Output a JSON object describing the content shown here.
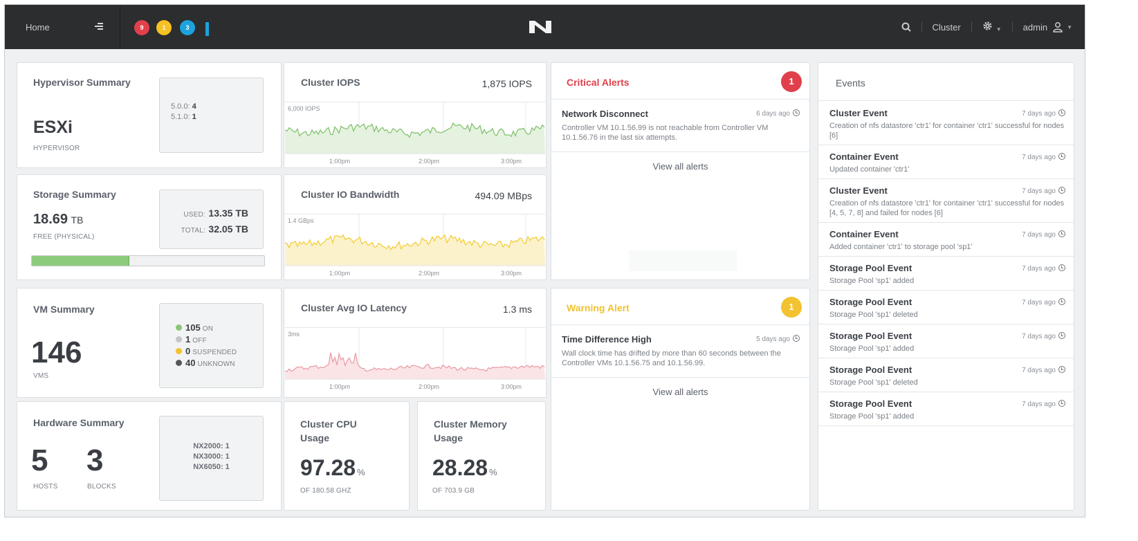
{
  "header": {
    "home_label": "Home",
    "alert_counts": {
      "critical": "9",
      "warning": "1",
      "info": "3"
    },
    "logo_text": "N",
    "cluster_label": "Cluster",
    "user_label": "admin"
  },
  "hypervisor": {
    "title": "Hypervisor Summary",
    "name": "ESXi",
    "caption": "HYPERVISOR",
    "versions": [
      {
        "label": "5.0.0:",
        "count": "4"
      },
      {
        "label": "5.1.0:",
        "count": "1"
      }
    ]
  },
  "storage": {
    "title": "Storage Summary",
    "free_value": "18.69",
    "free_unit": "TB",
    "free_caption": "FREE (PHYSICAL)",
    "used_label": "USED:",
    "used_value": "13.35 TB",
    "total_label": "TOTAL:",
    "total_value": "32.05 TB",
    "used_fraction": 0.42
  },
  "vm": {
    "title": "VM Summary",
    "count": "146",
    "caption": "VMS",
    "states": [
      {
        "count": "105",
        "label": "ON",
        "color": "#8cc47a"
      },
      {
        "count": "1",
        "label": "OFF",
        "color": "#c4c6c8"
      },
      {
        "count": "0",
        "label": "SUSPENDED",
        "color": "#f2c230"
      },
      {
        "count": "40",
        "label": "UNKNOWN",
        "color": "#55585c"
      }
    ]
  },
  "hardware": {
    "title": "Hardware Summary",
    "hosts": "5",
    "hosts_caption": "HOSTS",
    "blocks": "3",
    "blocks_caption": "BLOCKS",
    "models": [
      "NX2000: 1",
      "NX3000: 1",
      "NX6050: 1"
    ]
  },
  "charts": {
    "iops": {
      "title": "Cluster IOPS",
      "value": "1,875 IOPS",
      "max_label": "6,000 IOPS",
      "ticks": [
        "1:00pm",
        "2:00pm",
        "3:00pm"
      ],
      "line_color": "#7cbf68",
      "fill_color": "#e5f2df"
    },
    "bandwidth": {
      "title": "Cluster IO Bandwidth",
      "value": "494.09 MBps",
      "max_label": "1.4 GBps",
      "ticks": [
        "1:00pm",
        "2:00pm",
        "3:00pm"
      ],
      "line_color": "#f2cb2e",
      "fill_color": "#fbf2cc"
    },
    "latency": {
      "title": "Cluster Avg IO Latency",
      "value": "1.3 ms",
      "max_label": "3ms",
      "ticks": [
        "1:00pm",
        "2:00pm",
        "3:00pm"
      ],
      "line_color": "#e89aa1",
      "fill_color": "#fbe4e6"
    }
  },
  "cpu": {
    "title_line1": "Cluster CPU",
    "title_line2": "Usage",
    "value": "97.28",
    "unit": "%",
    "caption": "OF 180.58 GHz"
  },
  "memory": {
    "title_line1": "Cluster Memory",
    "title_line2": "Usage",
    "value": "28.28",
    "unit": "%",
    "caption": "OF 703.9 GB"
  },
  "critical_alerts": {
    "title": "Critical Alerts",
    "count": "1",
    "color": "#e0404b",
    "item": {
      "name": "Network Disconnect",
      "time": "6 days ago",
      "desc": "Controller VM 10.1.56.99 is not reachable from Controller VM 10.1.56.76 in the last six attempts."
    },
    "view_all": "View all alerts"
  },
  "warning_alerts": {
    "title": "Warning Alert",
    "count": "1",
    "color": "#f2c230",
    "item": {
      "name": "Time Difference High",
      "time": "5 days ago",
      "desc": "Wall clock time has drifted by more than 60 seconds between the Controller VMs 10.1.56.75 and 10.1.56.99."
    },
    "view_all": "View all alerts"
  },
  "events": {
    "title": "Events",
    "items": [
      {
        "name": "Cluster Event",
        "time": "7 days ago",
        "desc": "Creation of nfs datastore 'ctr1' for container 'ctr1' successful for nodes [6]"
      },
      {
        "name": "Container Event",
        "time": "7 days ago",
        "desc": "Updated container 'ctr1'"
      },
      {
        "name": "Cluster Event",
        "time": "7 days ago",
        "desc": "Creation of nfs datastore 'ctr1' for container 'ctr1' successful for nodes [4, 5, 7, 8] and failed for nodes [6]"
      },
      {
        "name": "Container Event",
        "time": "7 days ago",
        "desc": "Added container 'ctr1' to storage pool 'sp1'"
      },
      {
        "name": "Storage Pool Event",
        "time": "7 days ago",
        "desc": "Storage Pool 'sp1' added"
      },
      {
        "name": "Storage Pool Event",
        "time": "7 days ago",
        "desc": "Storage Pool 'sp1' deleted"
      },
      {
        "name": "Storage Pool Event",
        "time": "7 days ago",
        "desc": "Storage Pool 'sp1' added"
      },
      {
        "name": "Storage Pool Event",
        "time": "7 days ago",
        "desc": "Storage Pool 'sp1' deleted"
      },
      {
        "name": "Storage Pool Event",
        "time": "7 days ago",
        "desc": "Storage Pool 'sp1' added"
      }
    ]
  }
}
